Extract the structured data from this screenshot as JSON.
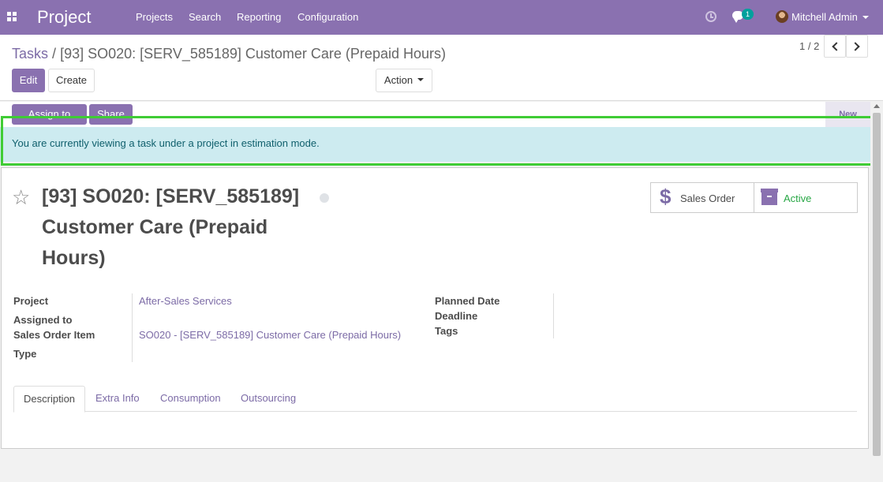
{
  "navbar": {
    "app_title": "Project",
    "menu": [
      "Projects",
      "Search",
      "Reporting",
      "Configuration"
    ],
    "chat_count": "1",
    "user_name": "Mitchell Admin"
  },
  "breadcrumb": {
    "parent": "Tasks",
    "separator": "/",
    "current": "[93] SO020: [SERV_585189] Customer Care (Prepaid Hours)"
  },
  "buttons": {
    "edit": "Edit",
    "create": "Create",
    "action": "Action"
  },
  "pager": {
    "value": "1 / 2"
  },
  "statusbar": {
    "assign_to_me": "Assign to Me",
    "share": "Share",
    "stage_new": "New"
  },
  "alert": {
    "text": "You are currently viewing a task under a project in estimation mode."
  },
  "task": {
    "title": "[93] SO020: [SERV_585189] Customer Care (Prepaid Hours)",
    "smart_buttons": {
      "sales_order": "Sales Order",
      "active": "Active"
    },
    "left_fields": {
      "project_label": "Project",
      "project_value": "After-Sales Services",
      "assigned_label": "Assigned to",
      "sales_order_item_label": "Sales Order Item",
      "sales_order_item_value": "SO020 - [SERV_585189] Customer Care (Prepaid Hours)",
      "type_label": "Type"
    },
    "right_fields": {
      "planned_date_label": "Planned Date",
      "deadline_label": "Deadline",
      "tags_label": "Tags"
    }
  },
  "tabs": [
    "Description",
    "Extra Info",
    "Consumption",
    "Outsourcing"
  ],
  "colors": {
    "brand": "#8a71b0",
    "alert_bg": "#cdebf0",
    "highlight": "#3fcc35",
    "active_status": "#28a745"
  }
}
